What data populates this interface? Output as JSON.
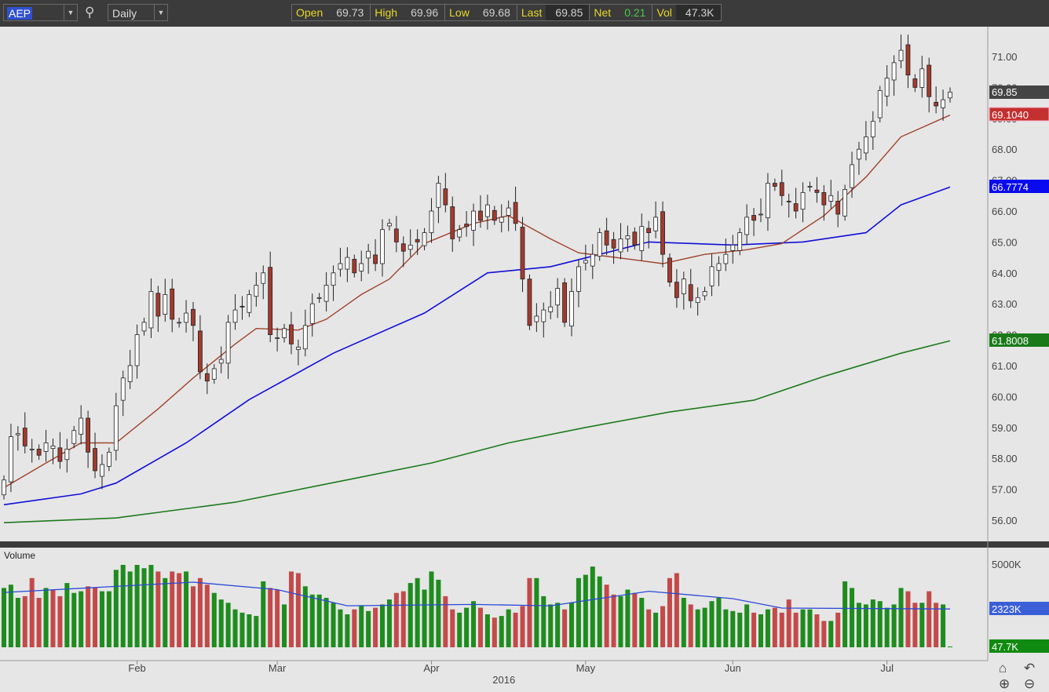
{
  "toolbar": {
    "symbol": "AEP",
    "interval": "Daily",
    "quote": [
      {
        "label": "Open",
        "value": "69.73"
      },
      {
        "label": "High",
        "value": "69.96"
      },
      {
        "label": "Low",
        "value": "69.68"
      },
      {
        "label": "Last",
        "value": "69.85"
      },
      {
        "label": "Net",
        "value": "0.21"
      },
      {
        "label": "Vol",
        "value": "47.3K"
      }
    ]
  },
  "colors": {
    "up_fill": "#ffffff",
    "down_fill": "#a33a2e",
    "ma20": "#a0442c",
    "ma50": "#1010d8",
    "ma200": "#1e7a1e",
    "vol_up": "#1e8c1e",
    "vol_down": "#c44a4a",
    "vol_ma": "#2a4ad8"
  },
  "chart_data": {
    "type": "candlestick",
    "title": "AEP Daily",
    "price_ticks": [
      "56.00",
      "57.00",
      "58.00",
      "59.00",
      "60.00",
      "61.00",
      "62.00",
      "63.00",
      "64.00",
      "65.00",
      "66.00",
      "67.00",
      "68.00",
      "69.00",
      "70.00",
      "71.00"
    ],
    "ylim": [
      55.3,
      71.9
    ],
    "months": [
      {
        "label": "Feb",
        "index": 19
      },
      {
        "label": "Mar",
        "index": 39
      },
      {
        "label": "Apr",
        "index": 61
      },
      {
        "label": "May",
        "index": 83
      },
      {
        "label": "Jun",
        "index": 104
      },
      {
        "label": "Jul",
        "index": 126
      }
    ],
    "year": {
      "label": "2016",
      "index": 71
    },
    "close": [
      57.3,
      58.7,
      58.8,
      58.4,
      58.3,
      58.1,
      58.5,
      58.4,
      57.9,
      58.3,
      58.9,
      59.3,
      58.2,
      57.6,
      57.8,
      58.2,
      59.7,
      60.6,
      61.0,
      62.0,
      62.4,
      63.4,
      62.6,
      63.3,
      62.5,
      62.4,
      62.7,
      62.3,
      60.8,
      60.5,
      60.9,
      61.2,
      62.4,
      62.8,
      62.9,
      63.3,
      63.6,
      64.0,
      62.0,
      61.9,
      62.2,
      61.7,
      61.6,
      62.3,
      63.0,
      63.2,
      63.6,
      64.0,
      64.3,
      64.5,
      64.0,
      64.3,
      64.7,
      64.3,
      65.4,
      65.6,
      65.0,
      64.7,
      64.9,
      65.0,
      65.3,
      66.0,
      66.9,
      66.2,
      65.1,
      65.4,
      65.5,
      66.0,
      65.7,
      66.2,
      65.7,
      65.8,
      66.1,
      65.6,
      63.8,
      62.3,
      62.6,
      62.8,
      62.9,
      63.5,
      62.4,
      63.4,
      64.2,
      64.4,
      64.6,
      65.3,
      64.9,
      64.8,
      65.1,
      65.2,
      64.9,
      65.5,
      65.3,
      65.8,
      64.6,
      63.7,
      63.2,
      63.8,
      63.1,
      63.2,
      63.4,
      64.2,
      64.3,
      64.6,
      64.9,
      65.3,
      65.8,
      65.7,
      65.9,
      66.9,
      66.8,
      66.5,
      66.3,
      66.0,
      66.6,
      66.8,
      66.6,
      66.2,
      66.5,
      65.9,
      66.7,
      67.5,
      68.0,
      68.4,
      68.9,
      69.9,
      70.3,
      70.8,
      71.2,
      70.4,
      70.0,
      70.6,
      69.7,
      69.4,
      69.6,
      69.85
    ],
    "ma20": {
      "label": "69.1040",
      "points": [
        [
          0,
          57.05
        ],
        [
          6,
          57.85
        ],
        [
          11,
          58.5
        ],
        [
          16,
          58.5
        ],
        [
          22,
          59.6
        ],
        [
          27,
          60.6
        ],
        [
          33,
          61.7
        ],
        [
          36,
          62.2
        ],
        [
          42,
          62.15
        ],
        [
          46,
          62.5
        ],
        [
          51,
          63.3
        ],
        [
          55,
          63.8
        ],
        [
          60,
          64.95
        ],
        [
          67,
          65.6
        ],
        [
          72,
          65.85
        ],
        [
          78,
          65.1
        ],
        [
          82,
          64.65
        ],
        [
          89,
          64.45
        ],
        [
          94,
          64.3
        ],
        [
          100,
          64.6
        ],
        [
          106,
          64.75
        ],
        [
          111,
          64.95
        ],
        [
          117,
          65.85
        ],
        [
          123,
          67.1
        ],
        [
          128,
          68.4
        ],
        [
          135,
          69.104
        ]
      ]
    },
    "ma50": {
      "label": "66.7774",
      "points": [
        [
          0,
          56.5
        ],
        [
          11,
          56.85
        ],
        [
          16,
          57.2
        ],
        [
          26,
          58.5
        ],
        [
          35,
          59.9
        ],
        [
          47,
          61.4
        ],
        [
          60,
          62.7
        ],
        [
          69,
          64.0
        ],
        [
          78,
          64.2
        ],
        [
          85,
          64.6
        ],
        [
          92,
          65.0
        ],
        [
          104,
          64.9
        ],
        [
          114,
          65.0
        ],
        [
          123,
          65.3
        ],
        [
          128,
          66.2
        ],
        [
          135,
          66.7774
        ]
      ]
    },
    "ma200": {
      "label": "61.8008",
      "points": [
        [
          0,
          55.92
        ],
        [
          16,
          56.07
        ],
        [
          33,
          56.58
        ],
        [
          50,
          57.35
        ],
        [
          61,
          57.85
        ],
        [
          72,
          58.5
        ],
        [
          83,
          59.0
        ],
        [
          95,
          59.5
        ],
        [
          107,
          59.88
        ],
        [
          117,
          60.65
        ],
        [
          128,
          61.4
        ],
        [
          135,
          61.8008
        ]
      ]
    },
    "last_label": "69.85",
    "volume": {
      "title": "Volume",
      "ticks": [
        "5000K"
      ],
      "max": 5000,
      "ma_label": "2323K",
      "last_label": "47.7K",
      "values": [
        3600,
        3800,
        3000,
        3100,
        4200,
        3000,
        3600,
        3500,
        3100,
        3900,
        3300,
        3400,
        3700,
        3600,
        3400,
        3400,
        4700,
        5000,
        4600,
        5000,
        4800,
        5000,
        4600,
        4200,
        4600,
        4500,
        4600,
        3700,
        4200,
        3800,
        3300,
        2900,
        2700,
        2300,
        2100,
        2000,
        1900,
        4000,
        3600,
        3500,
        2600,
        4600,
        4500,
        3700,
        3200,
        3200,
        3000,
        2700,
        2300,
        2000,
        2300,
        2500,
        2200,
        2400,
        2600,
        2900,
        3300,
        3400,
        3900,
        4200,
        3500,
        4600,
        4100,
        3100,
        2300,
        2100,
        2400,
        2800,
        2400,
        2000,
        1800,
        1900,
        2300,
        2100,
        2500,
        4200,
        4200,
        3100,
        2600,
        2700,
        2300,
        2700,
        4200,
        4400,
        4900,
        4300,
        3800,
        3200,
        3100,
        3500,
        3300,
        3000,
        2300,
        2100,
        2500,
        4200,
        4500,
        3000,
        2600,
        2300,
        2400,
        2800,
        3000,
        2300,
        2200,
        2100,
        2600,
        2100,
        2000,
        2300,
        2400,
        2100,
        2900,
        2100,
        2300,
        2300,
        2000,
        1600,
        1600,
        2100,
        4000,
        3600,
        2700,
        2600,
        2900,
        2800,
        2400,
        2600,
        3600,
        3400,
        2700,
        2700,
        3400,
        2700,
        2600,
        47.7
      ],
      "ma_points": [
        [
          0,
          3330
        ],
        [
          27,
          3950
        ],
        [
          39,
          3500
        ],
        [
          49,
          2520
        ],
        [
          67,
          2600
        ],
        [
          78,
          2520
        ],
        [
          92,
          3400
        ],
        [
          104,
          2950
        ],
        [
          111,
          2380
        ],
        [
          135,
          2323
        ]
      ]
    }
  }
}
